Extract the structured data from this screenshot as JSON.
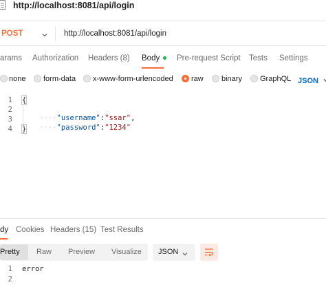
{
  "request": {
    "title": "http://localhost:8081/api/login",
    "method": "POST",
    "url": "http://localhost:8081/api/login"
  },
  "request_tabs": {
    "params": "arams",
    "authorization": "Authorization",
    "headers": "Headers (8)",
    "body": "Body",
    "prerequest": "Pre-request Script",
    "tests": "Tests",
    "settings": "Settings"
  },
  "body_options": {
    "none": "none",
    "form_data": "form-data",
    "urlencoded": "x-www-form-urlencoded",
    "raw": "raw",
    "binary": "binary",
    "graphql": "GraphQL",
    "format": "JSON"
  },
  "editor": {
    "line_numbers": [
      "1",
      "2",
      "3",
      "4"
    ],
    "open_brace": "{",
    "close_brace": "}",
    "key1": "\"username\"",
    "colon": ":",
    "val1": "\"ssar\"",
    "comma": ",",
    "key2": "\"password\"",
    "val2": "\"1234\""
  },
  "response_tabs": {
    "body": "dy",
    "cookies": "Cookies",
    "headers": "Headers (15)",
    "test_results": "Test Results"
  },
  "response_view": {
    "pretty": "Pretty",
    "raw": "Raw",
    "preview": "Preview",
    "visualize": "Visualize",
    "format": "JSON"
  },
  "response_body": {
    "line_numbers": [
      "1",
      "2"
    ],
    "line1": "error"
  },
  "colors": {
    "accent": "#ff6c37",
    "body_dot": "#0cbb52",
    "link_blue": "#0265d2"
  }
}
